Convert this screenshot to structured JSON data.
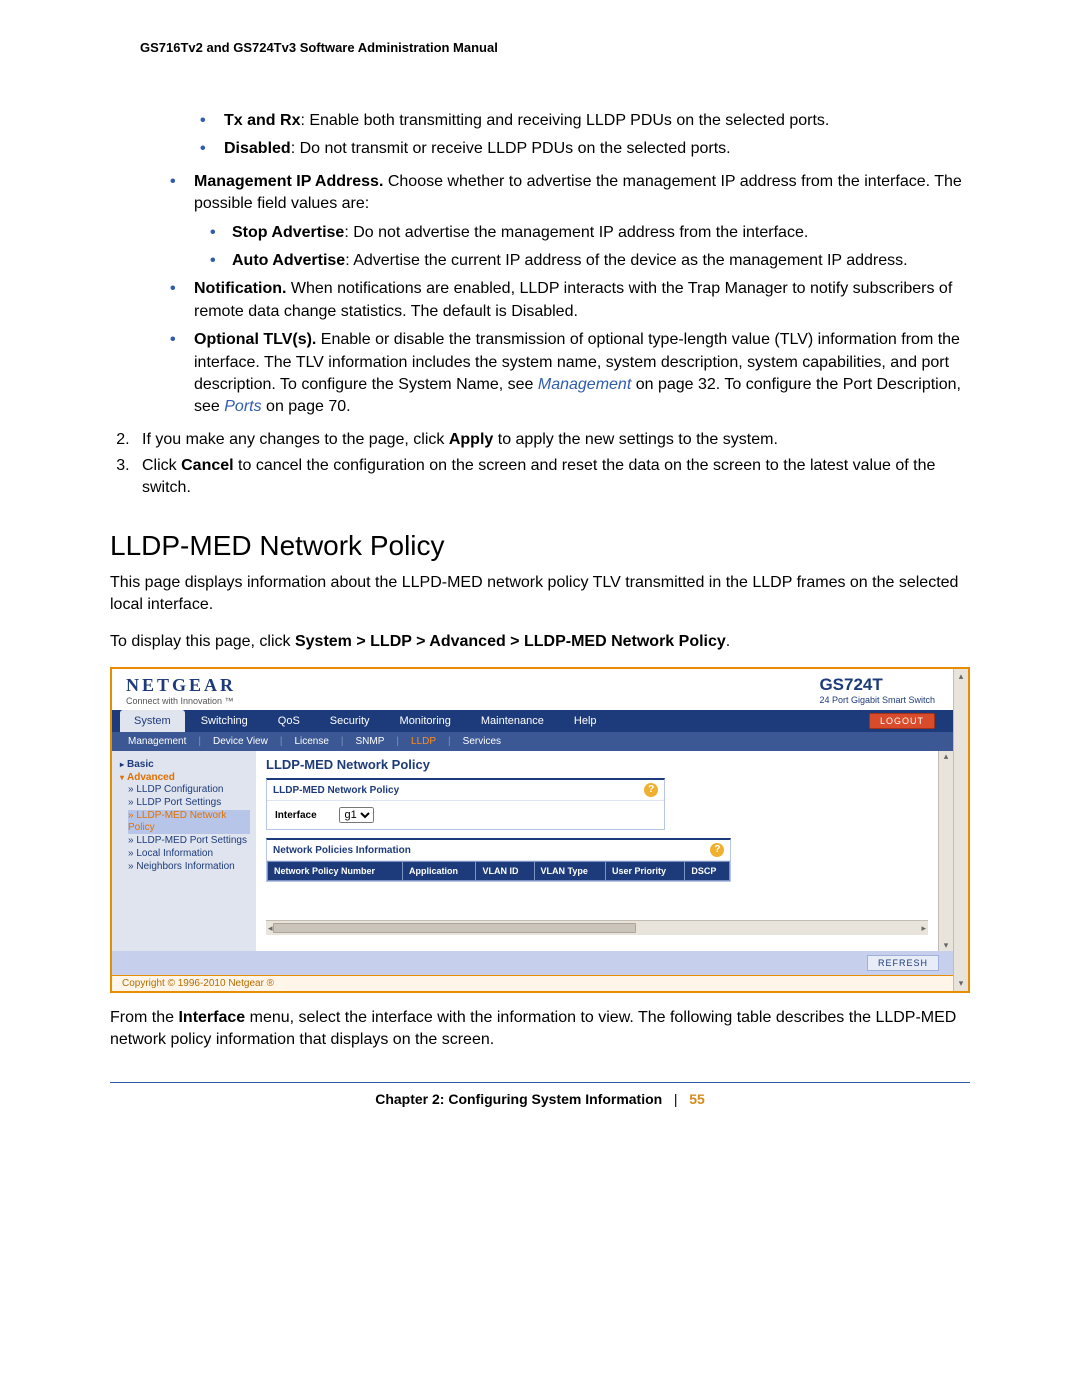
{
  "doc_header": "GS716Tv2 and GS724Tv3 Software Administration Manual",
  "opts": {
    "txrx_label": "Tx and Rx",
    "txrx_text": ": Enable both transmitting and receiving LLDP PDUs on the selected ports.",
    "disabled_label": "Disabled",
    "disabled_text": ": Do not transmit or receive LLDP PDUs on the selected ports.",
    "mgmt_label": "Management IP Address.",
    "mgmt_text": " Choose whether to advertise the management IP address from the interface. The possible field values are:",
    "stop_label": "Stop Advertise",
    "stop_text": ": Do not advertise the management IP address from the interface.",
    "auto_label": "Auto Advertise",
    "auto_text": ": Advertise the current IP address of the device as the management IP address.",
    "notif_label": "Notification.",
    "notif_text": " When notifications are enabled, LLDP interacts with the Trap Manager to notify subscribers of remote data change statistics. The default is Disabled.",
    "tlv_label": "Optional TLV(s).",
    "tlv_text_pre": " Enable or disable the transmission of optional type-length value (TLV) information from the interface. The TLV information includes the system name, system description, system capabilities, and port description. To configure the System Name, see ",
    "tlv_link1": "Management",
    "tlv_text_mid": " on page 32. To configure the Port Description, see ",
    "tlv_link2": "Ports",
    "tlv_text_post": " on page 70."
  },
  "steps": {
    "s2_pre": "If you make any changes to the page, click ",
    "s2_b": "Apply",
    "s2_post": " to apply the new settings to the system.",
    "s3_pre": "Click ",
    "s3_b": "Cancel",
    "s3_post": " to cancel the configuration on the screen and reset the data on the screen to the latest value of the switch."
  },
  "section_title": "LLDP-MED Network Policy",
  "para1": "This page displays information about the LLPD-MED network policy TLV transmitted in the LLDP frames on the selected local interface.",
  "para2_pre": "To display this page, click ",
  "para2_path": "System > LLDP > Advanced > LLDP-MED Network Policy",
  "para2_post": ".",
  "shot": {
    "logo": "NETGEAR",
    "tagline": "Connect with Innovation ™",
    "model": "GS724T",
    "subtitle": "24 Port Gigabit Smart Switch",
    "tabs": [
      "System",
      "Switching",
      "QoS",
      "Security",
      "Monitoring",
      "Maintenance",
      "Help"
    ],
    "logout": "LOGOUT",
    "subnav": [
      "Management",
      "Device View",
      "License",
      "SNMP",
      "LLDP",
      "Services"
    ],
    "subnav_selected_index": 4,
    "sidebar": {
      "basic": "Basic",
      "advanced": "Advanced",
      "items": [
        "LLDP Configuration",
        "LLDP Port Settings",
        "LLDP-MED Network Policy",
        "LLDP-MED Port Settings",
        "Local Information",
        "Neighbors Information"
      ]
    },
    "panel_title": "LLDP-MED Network Policy",
    "panel1_head": "LLDP-MED Network Policy",
    "interface_label": "Interface",
    "interface_value": "g1",
    "panel2_head": "Network Policies Information",
    "columns": [
      "Network Policy Number",
      "Application",
      "VLAN ID",
      "VLAN Type",
      "User Priority",
      "DSCP"
    ],
    "refresh": "REFRESH",
    "copyright": "Copyright © 1996-2010 Netgear ®"
  },
  "post_shot_pre": "From the ",
  "post_shot_b": "Interface",
  "post_shot_post": " menu, select the interface with the information to view. The following table describes the LLDP-MED network policy information that displays on the screen.",
  "footer": {
    "chapter": "Chapter 2:  Configuring System Information",
    "sep": "|",
    "page": "55"
  }
}
